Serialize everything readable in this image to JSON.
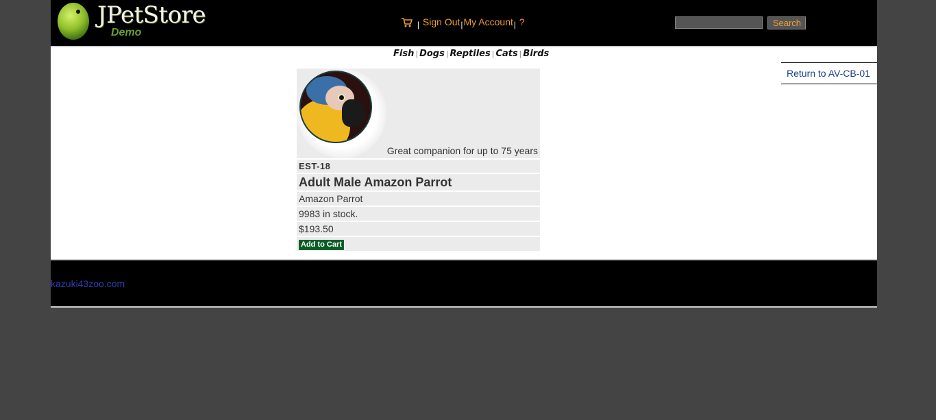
{
  "header": {
    "logo_title": "JPetStore",
    "logo_subtitle": "Demo",
    "menu": {
      "sign_out": "Sign Out",
      "my_account": "My Account",
      "help": "?",
      "separator": "|"
    },
    "search": {
      "value": "",
      "button_label": "Search"
    }
  },
  "quicklinks": [
    "Fish",
    "Dogs",
    "Reptiles",
    "Cats",
    "Birds"
  ],
  "back_link": "Return to AV-CB-01",
  "item": {
    "image_icon": "amazon-parrot-image",
    "description": "Great companion for up to 75 years",
    "id": "EST-18",
    "name": "Adult Male Amazon Parrot",
    "product": "Amazon Parrot",
    "stock": "9983 in stock.",
    "price": "$193.50",
    "add_to_cart_label": "Add to Cart"
  },
  "footer": {
    "link": "kazuki43zoo.com"
  },
  "colors": {
    "background": "#444444",
    "header_bg": "#000000",
    "menu_link": "#f0a030",
    "cell_bg": "#ebebeb",
    "add_to_cart_bg": "#0b5b24",
    "back_link": "#1f3e8a",
    "footer_link": "#2a3fb0"
  }
}
